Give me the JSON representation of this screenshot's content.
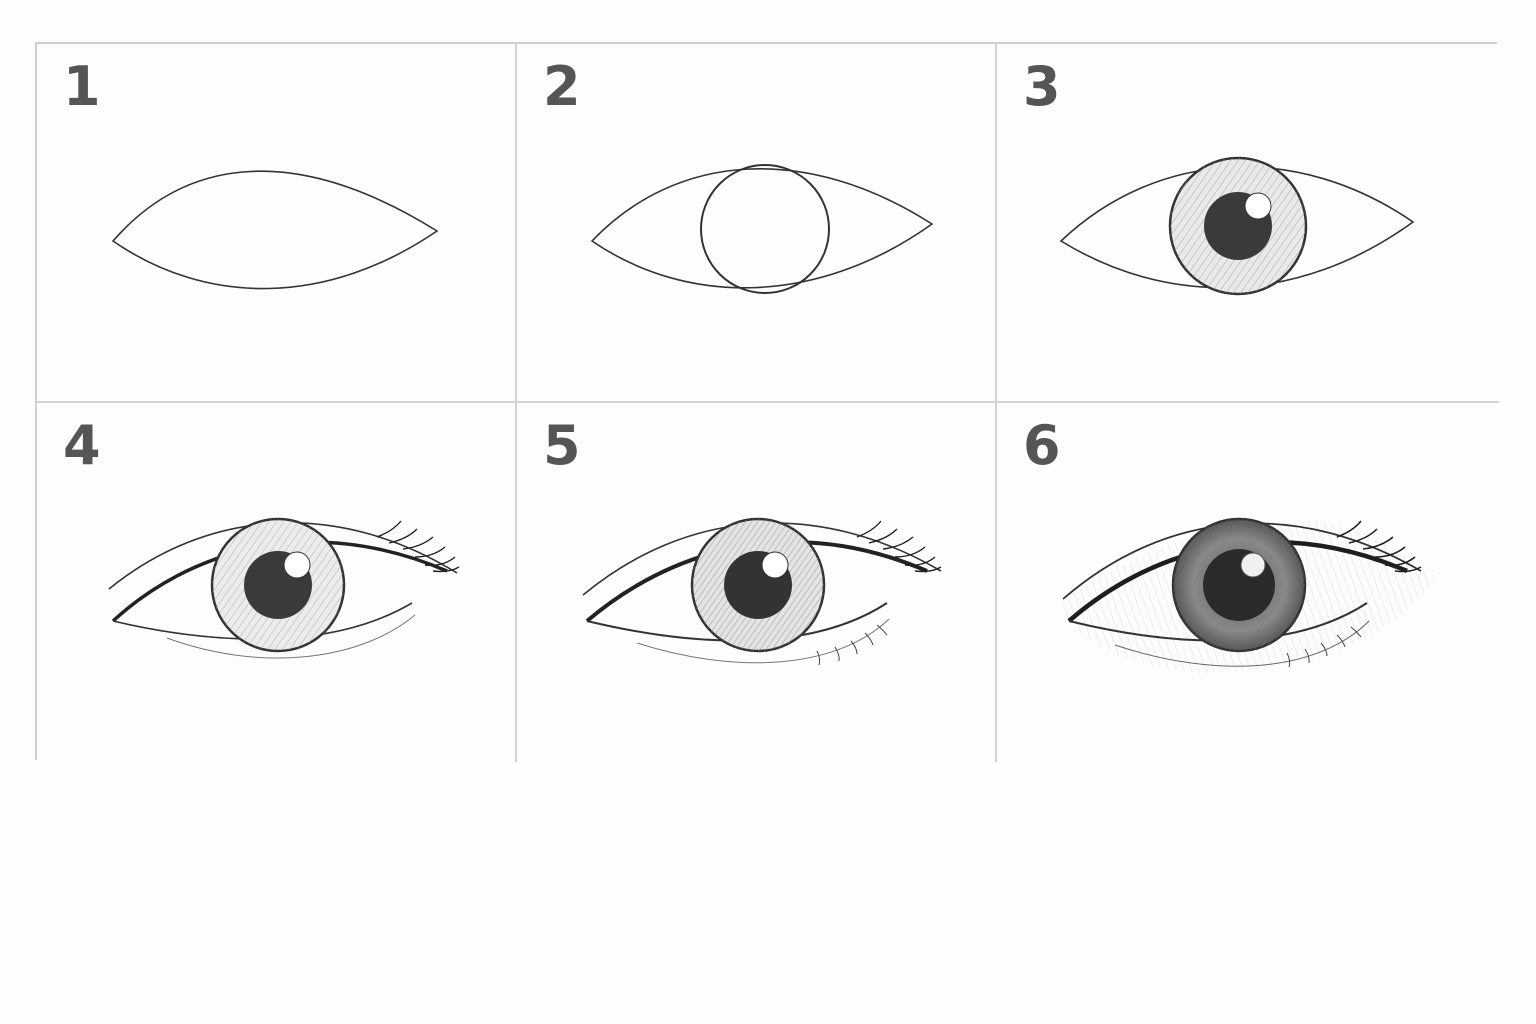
{
  "steps": [
    {
      "number": "1"
    },
    {
      "number": "2"
    },
    {
      "number": "3"
    },
    {
      "number": "4"
    },
    {
      "number": "5"
    },
    {
      "number": "6"
    }
  ],
  "colors": {
    "border": "#cfcfcf",
    "label": "#555555",
    "stroke": "#333333",
    "pupil": "#3a3a3a",
    "iris": "#9a9a9a"
  }
}
